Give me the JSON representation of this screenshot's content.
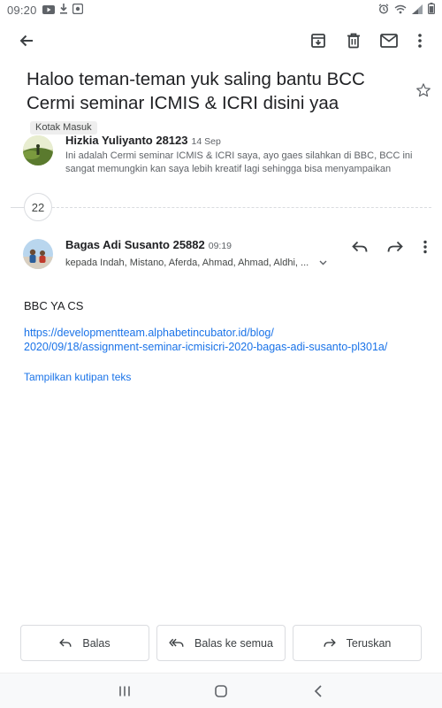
{
  "status_bar": {
    "time": "09:20",
    "left_icons": [
      "youtube-icon",
      "download-icon",
      "app-notification-icon"
    ],
    "right_icons": [
      "alarm-icon",
      "wifi-icon",
      "signal-icon",
      "battery-icon"
    ]
  },
  "app_bar": {
    "back": "arrow-back-icon",
    "actions": [
      "archive-icon",
      "delete-icon",
      "mark-unread-icon",
      "more-vert-icon"
    ]
  },
  "thread": {
    "subject": "Haloo teman-teman yuk saling bantu BCC Cermi seminar ICMIS & ICRI disini yaa",
    "label": "Kotak Masuk",
    "starred": false
  },
  "message_1": {
    "sender": "Hizkia Yuliyanto 28123",
    "date": "14 Sep",
    "snippet": "Ini adalah Cermi seminar ICMIS & ICRI saya, ayo gaes silahkan di BBC, BCC ini sangat memungkin kan saya lebih kreatif lagi sehingga bisa menyampaikan"
  },
  "collapsed": {
    "count": "22"
  },
  "message_2": {
    "sender": "Bagas Adi Susanto 25882",
    "time": "09:19",
    "recipients": "kepada Indah, Mistano, Aferda, Ahmad, Ahmad, Aldhi, ...",
    "body": "BBC YA CS",
    "link_line1": "https://developmentteam.alphabetincubator.id/blog/",
    "link_line2": "2020/09/18/assignment-seminar-icmisicri-2020-bagas-adi-susanto-pl301a/",
    "show_quoted": "Tampilkan kutipan teks"
  },
  "actions": {
    "reply": "Balas",
    "reply_all": "Balas ke semua",
    "forward": "Teruskan"
  },
  "colors": {
    "accent_link": "#1a73e8",
    "text_primary": "#202124",
    "text_secondary": "#5f6368"
  }
}
